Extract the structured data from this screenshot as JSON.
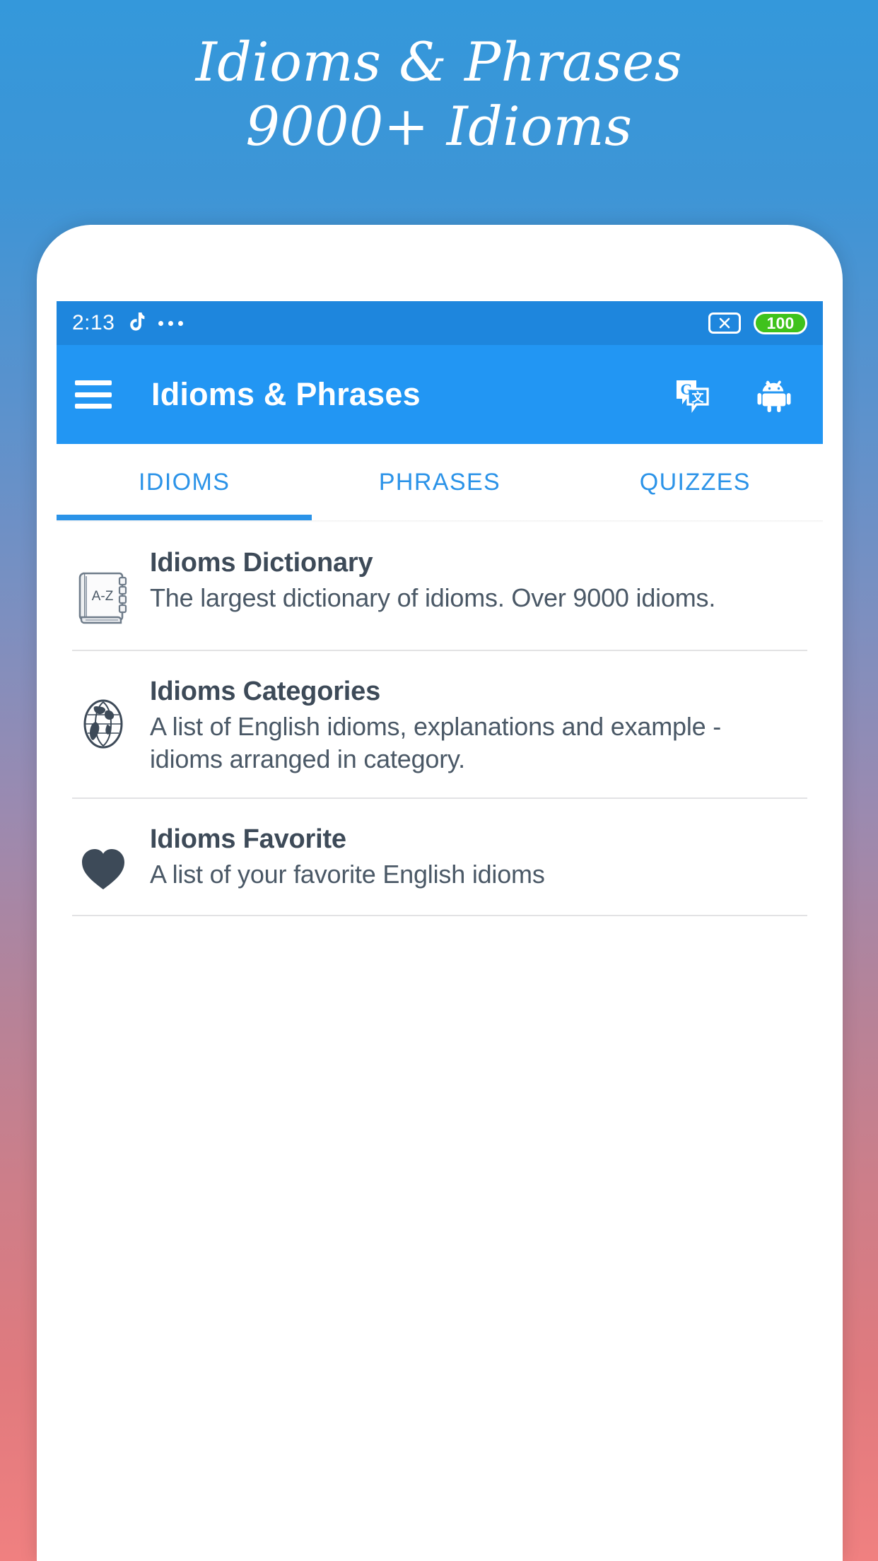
{
  "promo": {
    "line1": "Idioms & Phrases",
    "line2": "9000+ Idioms"
  },
  "colors": {
    "statusbar_bg": "#1e86dd",
    "appbar_bg": "#2296f3",
    "accent": "#2b93e8",
    "battery_green": "#3fc21c",
    "text_dark": "#3d4a58",
    "divider": "#e2e2e4",
    "gradient_top": "#3498db",
    "gradient_bottom": "#f08080"
  },
  "statusbar": {
    "time": "2:13",
    "tiktok_icon": "tiktok-note-icon",
    "overflow_icon": "more-dots-icon",
    "sim_icon": "no-sim-icon",
    "battery_level": "100"
  },
  "appbar": {
    "menu_icon": "hamburger-menu-icon",
    "title": "Idioms & Phrases",
    "translate_icon": "google-translate-icon",
    "android_icon": "android-robot-icon"
  },
  "tabs": {
    "active_index": 0,
    "items": [
      {
        "label": "IDIOMS"
      },
      {
        "label": "PHRASES"
      },
      {
        "label": "QUIZZES"
      }
    ]
  },
  "list": {
    "items": [
      {
        "icon": "dictionary-book-az-icon",
        "icon_label": "A-Z",
        "title": "Idioms Dictionary",
        "subtitle": "The largest dictionary of idioms. Over 9000 idioms."
      },
      {
        "icon": "globe-icon",
        "title": "Idioms Categories",
        "subtitle": "A list of English idioms, explanations and example - idioms arranged in category."
      },
      {
        "icon": "heart-icon",
        "title": "Idioms Favorite",
        "subtitle": "A list of your favorite English idioms"
      }
    ]
  }
}
